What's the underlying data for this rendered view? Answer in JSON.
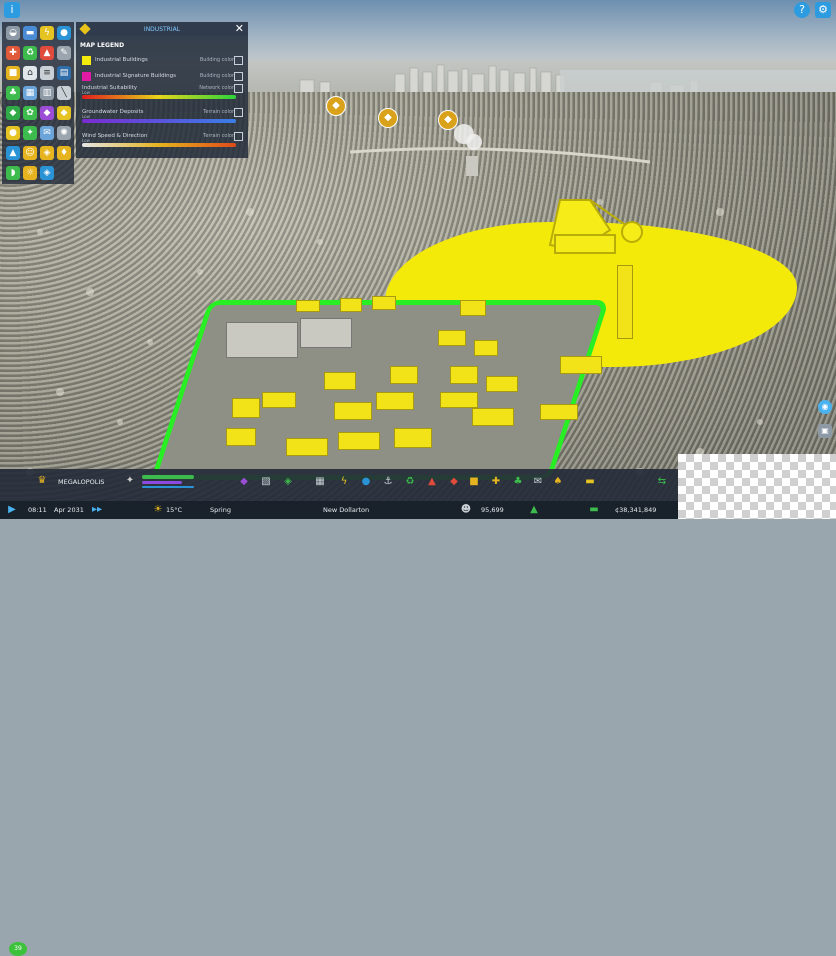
{
  "panel": {
    "title": "INDUSTRIAL",
    "legend_title": "MAP LEGEND",
    "close": "✕",
    "items": [
      {
        "label": "Industrial Buildings",
        "mode": "Building color",
        "color": "#f4ea0c"
      },
      {
        "label": "Industrial Signature Buildings",
        "mode": "Building color",
        "color": "#e01aa5"
      }
    ],
    "gradients": [
      {
        "label": "Industrial Suitability",
        "mode": "Network color",
        "low": "Low",
        "high": "High"
      },
      {
        "label": "Groundwater Deposits",
        "mode": "Terrain color",
        "low": "Low",
        "high": "High"
      },
      {
        "label": "Wind Speed & Direction",
        "mode": "Terrain color",
        "low": "Low",
        "high": "High"
      }
    ]
  },
  "top": {
    "info_icon": "i",
    "help_icon": "?",
    "settings_icon": "⚙"
  },
  "bottom": {
    "milestone_count": "39",
    "city_title": "MEGALOPOLIS",
    "time": "08:11",
    "date": "Apr 2031",
    "temperature": "15°C",
    "season": "Spring",
    "city_name": "New Dollarton",
    "population": "95,699",
    "money": "¢38,341,849"
  }
}
